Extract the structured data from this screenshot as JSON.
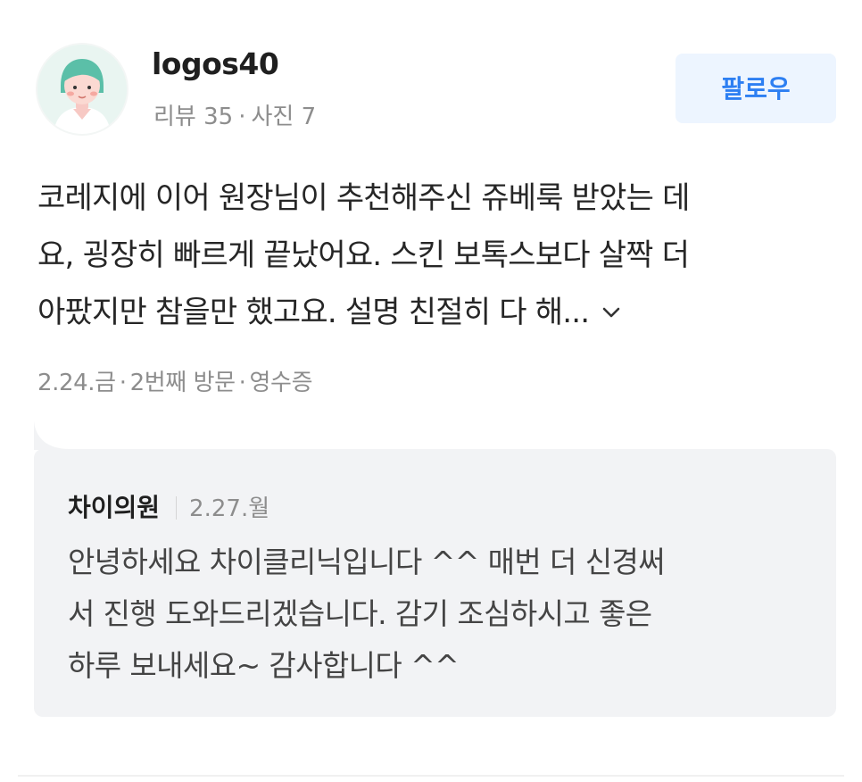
{
  "user": {
    "name": "logos40",
    "review_count_label": "리뷰 35",
    "photo_count_label": "사진 7",
    "stats_separator": "·"
  },
  "follow_button": {
    "label": "팔로우",
    "color": "#2d7ff2",
    "background": "#edf5ff"
  },
  "review": {
    "text_lines": [
      "코레지에 이어 원장님이 추천해주신 쥬베룩 받았는 데",
      "요, 굉장히 빠르게 끝났어요. 스킨 보톡스보다 살짝 더",
      "아팠지만 참을만 했고요. 설명 친절히 다 해..."
    ],
    "expand_icon": "chevron-down-icon",
    "meta": {
      "date": "2.24.금",
      "visit": "2번째 방문",
      "verification": "영수증",
      "separator": "·"
    }
  },
  "owner_reply": {
    "author": "차이의원",
    "date": "2.27.월",
    "text_lines": [
      "안녕하세요 차이클리닉입니다 ^^ 매번 더 신경써",
      "서 진행 도와드리겠습니다. 감기 조심하시고 좋은",
      "하루 보내세요~ 감사합니다 ^^"
    ],
    "background": "#f2f3f5"
  },
  "avatar": {
    "icon": "user-avatar-icon",
    "background": "#e9f5f1"
  }
}
